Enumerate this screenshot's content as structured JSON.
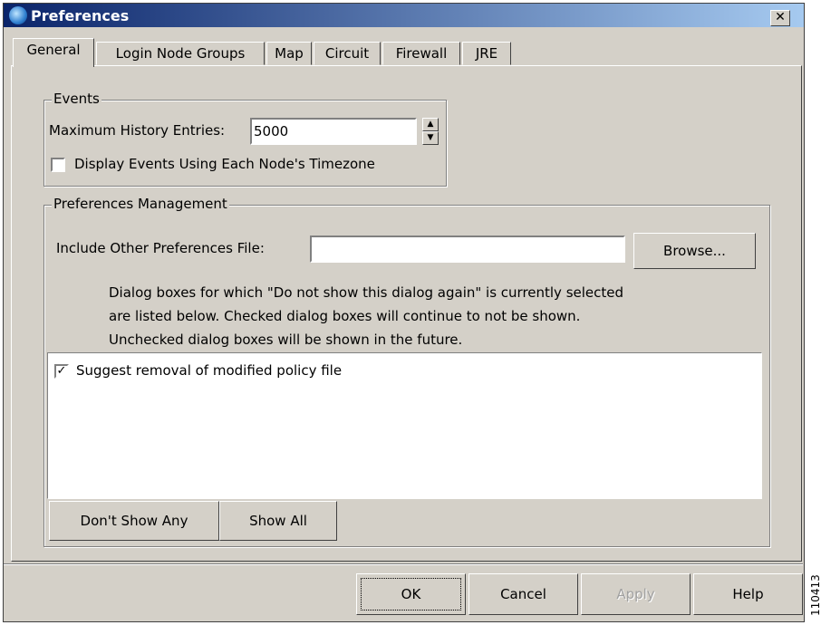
{
  "window": {
    "title": "Preferences",
    "close_icon": "close-icon",
    "app_icon": "globe-icon"
  },
  "tabs": [
    {
      "label": "General",
      "active": true
    },
    {
      "label": "Login Node Groups"
    },
    {
      "label": "Map"
    },
    {
      "label": "Circuit"
    },
    {
      "label": "Firewall"
    },
    {
      "label": "JRE"
    }
  ],
  "events": {
    "legend": "Events",
    "max_history_label": "Maximum History Entries:",
    "max_history_value": "5000",
    "timezone_label": "Display Events Using Each Node's Timezone",
    "timezone_checked": false
  },
  "prefs": {
    "legend": "Preferences Management",
    "include_label": "Include Other Preferences File:",
    "include_value": "",
    "browse_label": "Browse...",
    "info_line1": "Dialog boxes for which \"Do not show this dialog again\" is currently selected",
    "info_line2": "are listed below. Checked dialog boxes will continue to not be shown.",
    "info_line3": "Unchecked dialog boxes will be shown in the future.",
    "list_items": [
      {
        "label": "Suggest removal of modified policy file",
        "checked": true
      }
    ],
    "dont_show_any_label": "Don't Show Any",
    "show_all_label": "Show All"
  },
  "footer": {
    "ok_label": "OK",
    "cancel_label": "Cancel",
    "apply_label": "Apply",
    "help_label": "Help"
  },
  "side_code": "110413"
}
